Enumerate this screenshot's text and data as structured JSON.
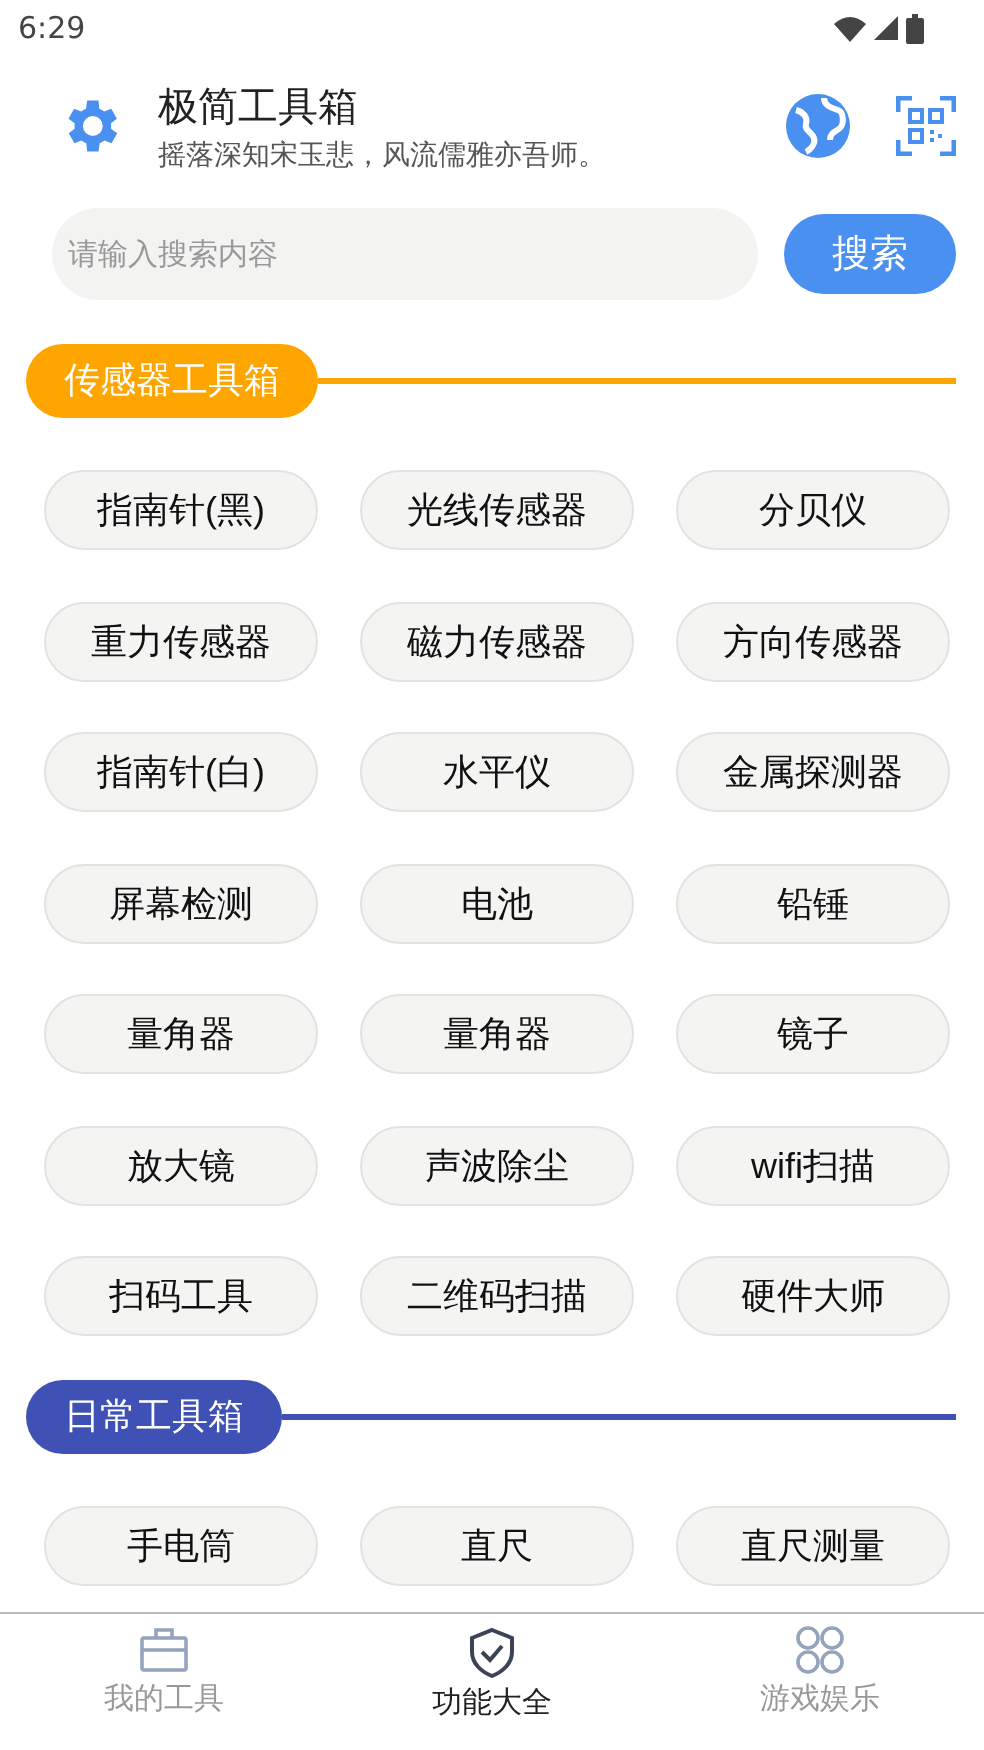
{
  "status_bar": {
    "time": "6:29"
  },
  "header": {
    "title": "极简工具箱",
    "subtitle": "摇落深知宋玉悲，风流儒雅亦吾师。"
  },
  "search": {
    "placeholder": "请输入搜索内容",
    "button": "搜索"
  },
  "sections": [
    {
      "title": "传感器工具箱",
      "color": "#ffa500",
      "tools": [
        "指南针(黑)",
        "光线传感器",
        "分贝仪",
        "重力传感器",
        "磁力传感器",
        "方向传感器",
        "指南针(白)",
        "水平仪",
        "金属探测器",
        "屏幕检测",
        "电池",
        "铅锤",
        "量角器",
        "量角器",
        "镜子",
        "放大镜",
        "声波除尘",
        "wifi扫描",
        "扫码工具",
        "二维码扫描",
        "硬件大师"
      ]
    },
    {
      "title": "日常工具箱",
      "color": "#3f51b5",
      "tools": [
        "手电筒",
        "直尺",
        "直尺测量"
      ]
    }
  ],
  "bottom_nav": [
    {
      "label": "我的工具",
      "kind": "toolbox",
      "selected": false
    },
    {
      "label": "功能大全",
      "kind": "shield",
      "selected": true
    },
    {
      "label": "游戏娱乐",
      "kind": "apps",
      "selected": false
    }
  ]
}
